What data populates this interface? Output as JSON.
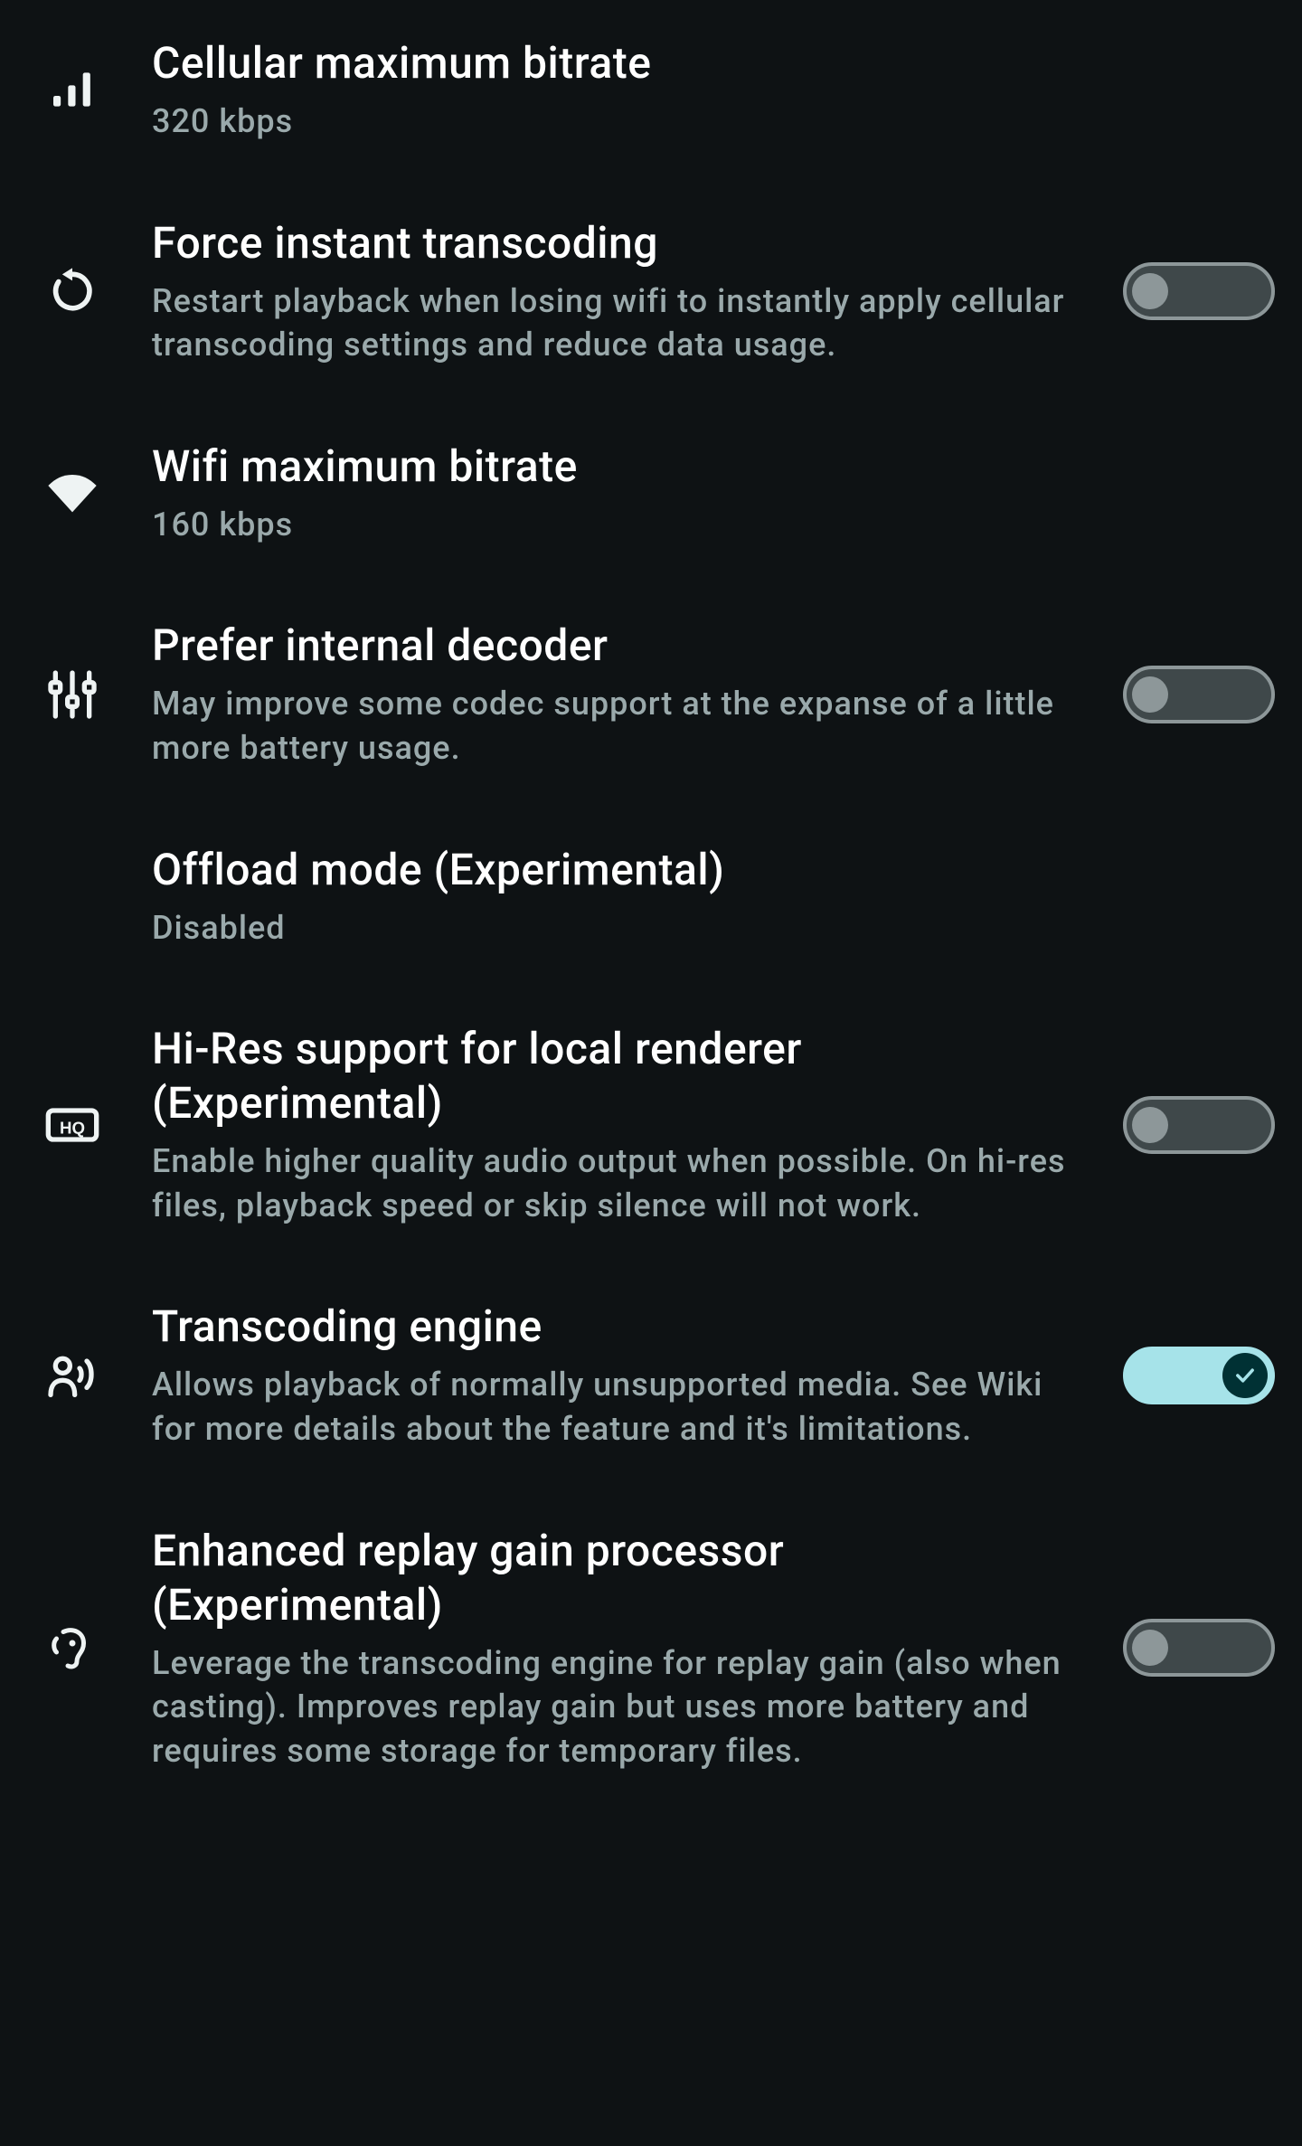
{
  "settings": [
    {
      "key": "cellular_max_bitrate",
      "title": "Cellular maximum bitrate",
      "subtitle": "320 kbps",
      "icon": "signal-bars-icon",
      "control": "none"
    },
    {
      "key": "force_instant_transcoding",
      "title": "Force instant transcoding",
      "subtitle": "Restart playback when losing wifi to instantly apply cellular transcoding settings and reduce data usage.",
      "icon": "reload-icon",
      "control": "toggle",
      "value": false
    },
    {
      "key": "wifi_max_bitrate",
      "title": "Wifi maximum bitrate",
      "subtitle": "160 kbps",
      "icon": "wifi-icon",
      "control": "none"
    },
    {
      "key": "prefer_internal_decoder",
      "title": "Prefer internal decoder",
      "subtitle": "May improve some codec support at the expanse of a little more battery usage.",
      "icon": "sliders-icon",
      "control": "toggle",
      "value": false
    },
    {
      "key": "offload_mode",
      "title": "Offload mode (Experimental)",
      "subtitle": "Disabled",
      "icon": null,
      "control": "none"
    },
    {
      "key": "hires_support",
      "title": "Hi-Res support for local renderer (Experimental)",
      "subtitle": "Enable higher quality audio output when possible. On hi-res files, playback speed or skip silence will not work.",
      "icon": "hq-icon",
      "control": "toggle",
      "value": false
    },
    {
      "key": "transcoding_engine",
      "title": "Transcoding engine",
      "subtitle": "Allows playback of normally unsupported media. See Wiki for more details about the feature and it's limitations.",
      "icon": "voice-icon",
      "control": "toggle",
      "value": true
    },
    {
      "key": "enhanced_replay_gain",
      "title": "Enhanced replay gain processor (Experimental)",
      "subtitle": "Leverage the transcoding engine for replay gain (also when casting). Improves replay gain but uses more battery and requires some storage for temporary files.",
      "icon": "ear-icon",
      "control": "toggle",
      "value": false
    }
  ],
  "colors": {
    "background": "#0e1214",
    "text_primary": "#ffffff",
    "text_secondary": "#9aa9ab",
    "toggle_off_track": "#3f484a",
    "toggle_off_border": "#8d9799",
    "toggle_on": "#a6e3e9",
    "toggle_on_knob": "#003134"
  }
}
